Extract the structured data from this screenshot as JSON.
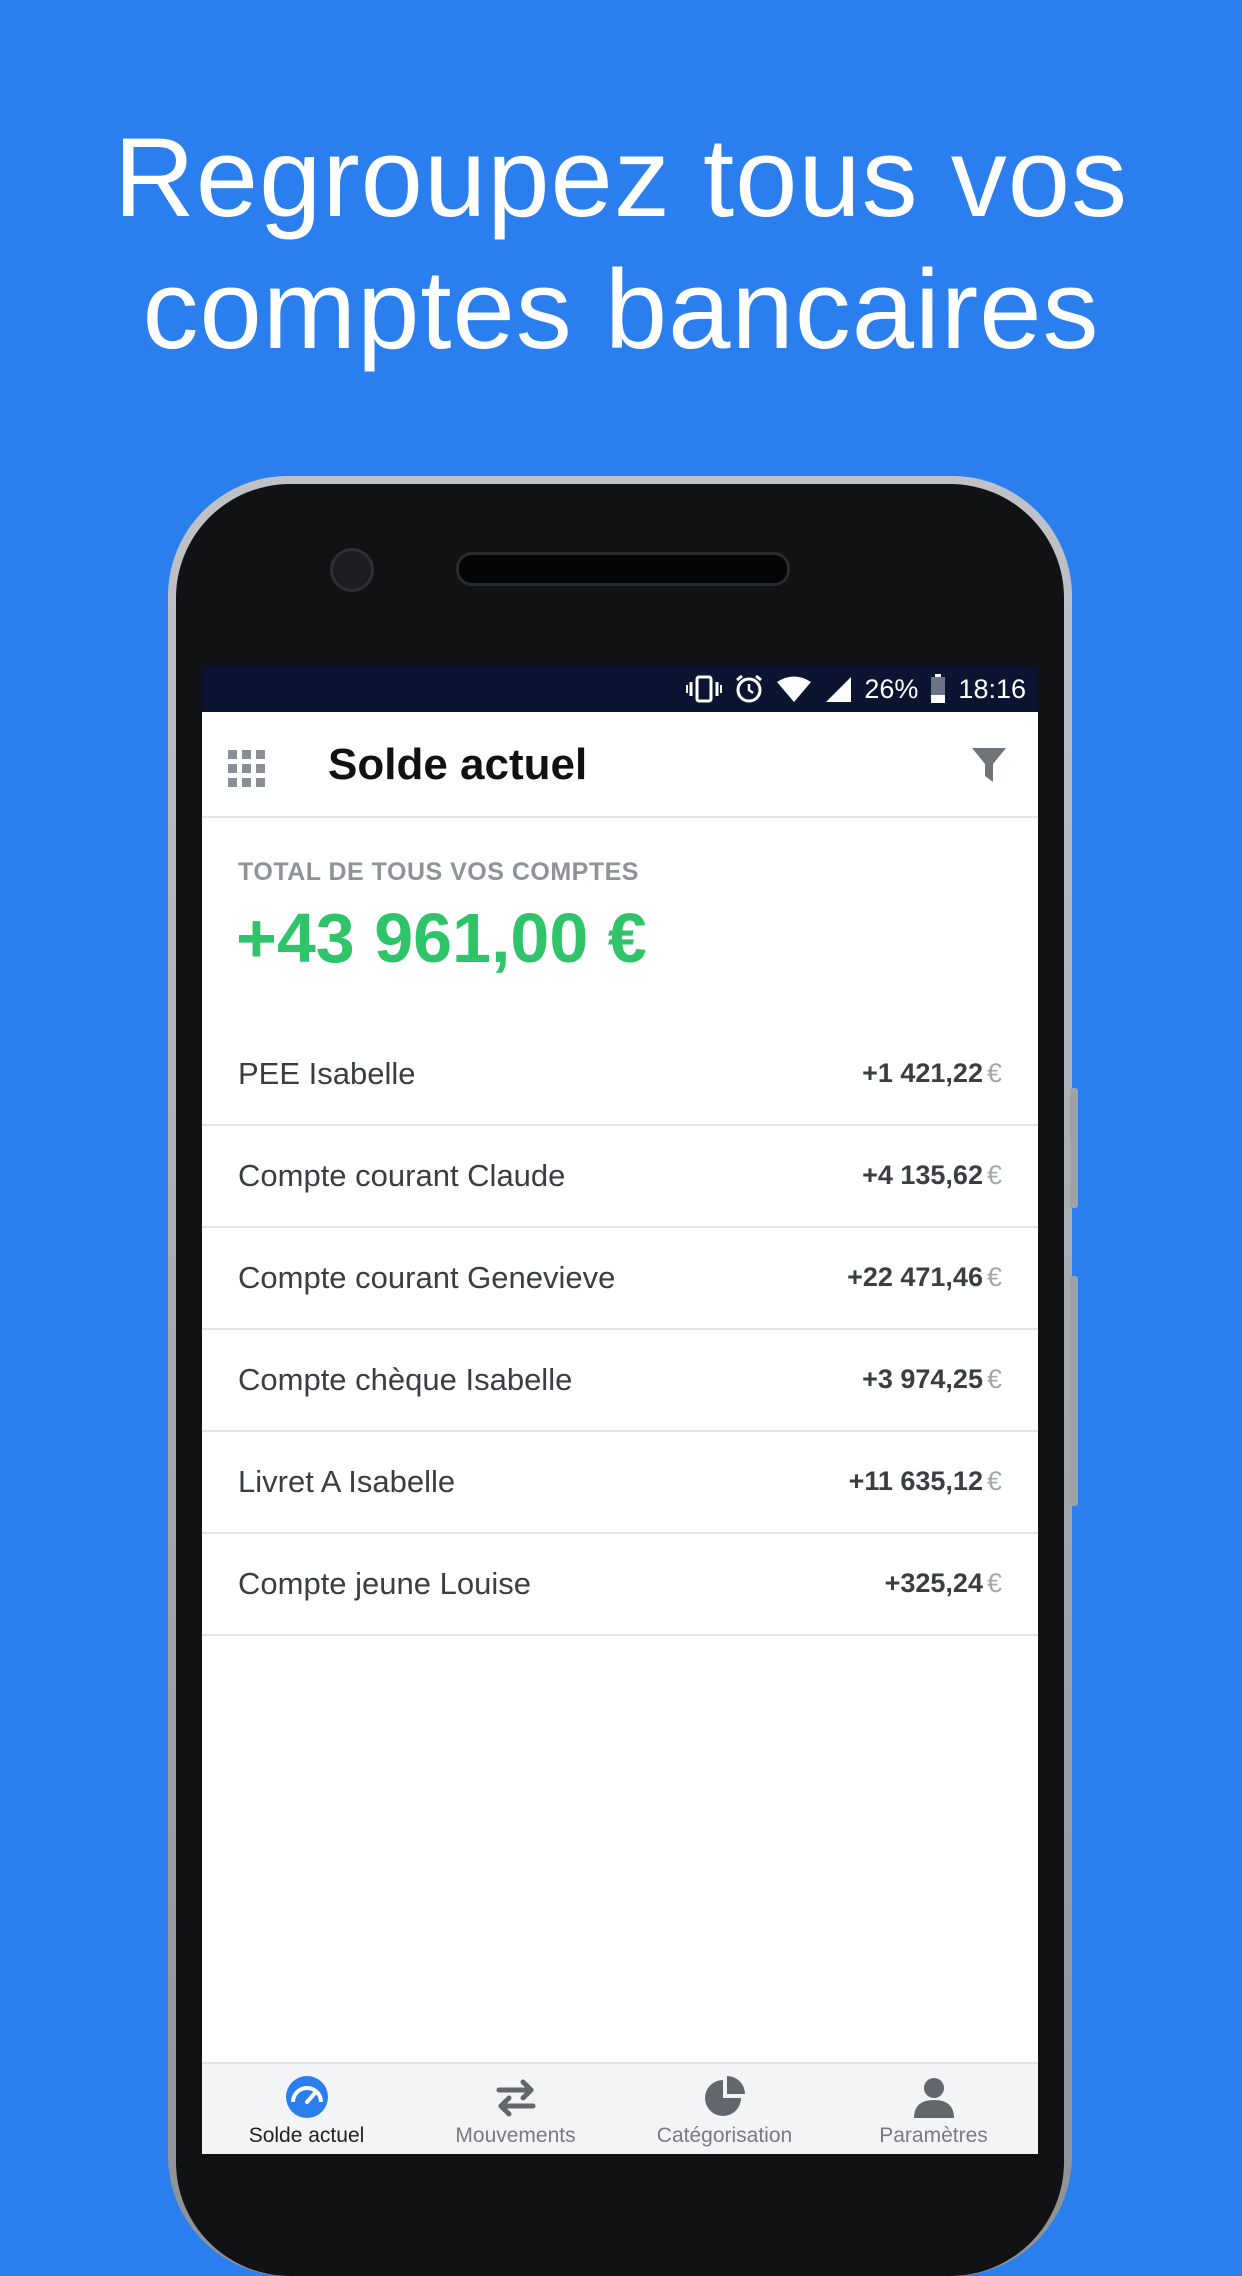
{
  "headline": {
    "line1": "Regroupez tous vos",
    "line2": "comptes bancaires"
  },
  "statusbar": {
    "battery": "26%",
    "time": "18:16",
    "icons": [
      "vibrate-icon",
      "alarm-icon",
      "wifi-icon",
      "signal-icon",
      "battery-icon"
    ]
  },
  "appbar": {
    "title": "Solde actuel",
    "menu_icon": "grid-icon",
    "filter_icon": "filter-icon"
  },
  "total": {
    "label": "TOTAL DE TOUS VOS COMPTES",
    "value": "+43 961,00 €"
  },
  "accounts": [
    {
      "name": "PEE Isabelle",
      "amount": "+1 421,22",
      "currency": "€"
    },
    {
      "name": "Compte courant Claude",
      "amount": "+4 135,62",
      "currency": "€"
    },
    {
      "name": "Compte courant Genevieve",
      "amount": "+22 471,46",
      "currency": "€"
    },
    {
      "name": "Compte chèque Isabelle",
      "amount": "+3 974,25",
      "currency": "€"
    },
    {
      "name": "Livret A Isabelle",
      "amount": "+11 635,12",
      "currency": "€"
    },
    {
      "name": "Compte jeune Louise",
      "amount": "+325,24",
      "currency": "€"
    }
  ],
  "tabs": [
    {
      "label": "Solde actuel",
      "icon": "gauge-icon",
      "active": true
    },
    {
      "label": "Mouvements",
      "icon": "transfer-arrows-icon",
      "active": false
    },
    {
      "label": "Catégorisation",
      "icon": "pie-chart-icon",
      "active": false
    },
    {
      "label": "Paramètres",
      "icon": "user-icon",
      "active": false
    }
  ],
  "colors": {
    "background": "#2b7eee",
    "total_green": "#2fc36a",
    "active_tab": "#2b7eee"
  }
}
